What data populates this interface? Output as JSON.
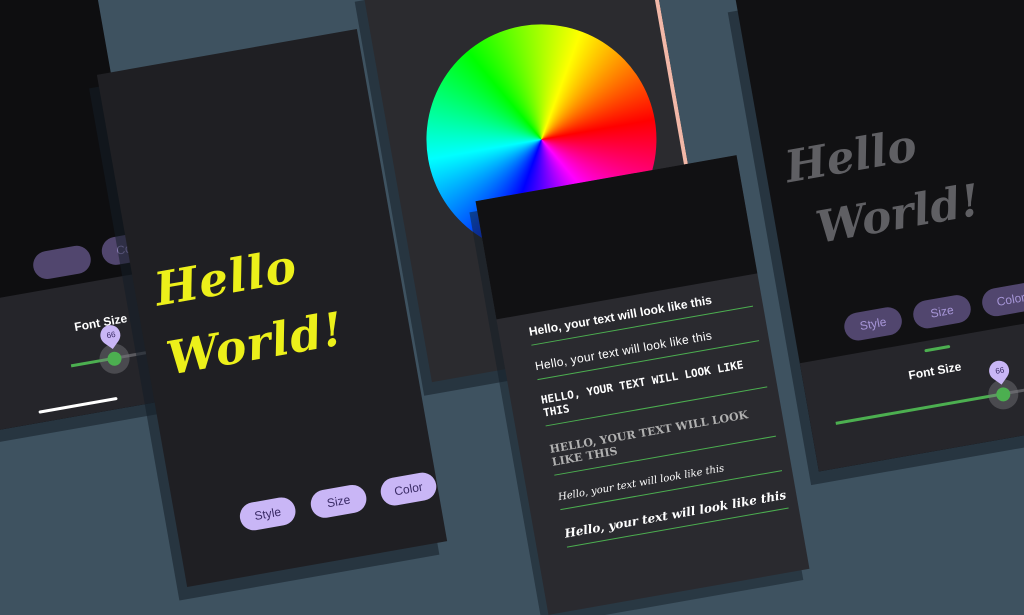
{
  "preview_text": {
    "line1": "Hello",
    "line2": "World!"
  },
  "buttons": {
    "style": "Style",
    "size": "Size",
    "color": "Color"
  },
  "font_size": {
    "label": "Font Size",
    "value": "66",
    "fraction": 0.66
  },
  "font_list": {
    "items": [
      "Hello, your text will look like this",
      "Hello, your text will look like this",
      "HELLO, YOUR TEXT WILL LOOK LIKE THIS",
      "HELLO, YOUR TEXT WILL LOOK LIKE THIS",
      "Hello, your text will look like this",
      "Hello, your text will look like this"
    ]
  },
  "colors": {
    "background": "#3e5260",
    "hello_text": "#ecf01a",
    "accent_green": "#4caf50",
    "button_light": "#c9b6f6",
    "button_dim": "#51466e"
  }
}
